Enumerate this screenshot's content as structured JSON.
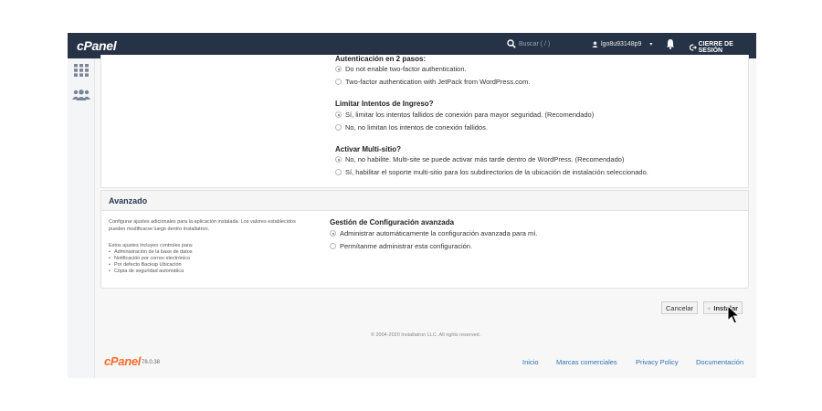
{
  "header": {
    "logo_text": "cPanel",
    "search_placeholder": "Buscar ( / )",
    "user": "lgo8u93148p9",
    "logout": "CIERRE DE SESIÓN"
  },
  "sidebar": {
    "icons": [
      "grid-icon",
      "users-icon"
    ]
  },
  "settings": {
    "two_factor": {
      "title": "Autenticación en 2 pasos:",
      "options": [
        {
          "label": "Do not enable two-factor authentication.",
          "selected": true
        },
        {
          "label": "Two-factor authentication with JetPack from WordPress.com.",
          "selected": false
        }
      ]
    },
    "limit_login": {
      "title": "Limitar Intentos de Ingreso?",
      "options": [
        {
          "label": "Sí, limitar los intentos fallidos de conexión para mayor seguridad. (Recomendado)",
          "selected": true
        },
        {
          "label": "No, no limitan los intentos de conexión fallidos.",
          "selected": false
        }
      ]
    },
    "multisite": {
      "title": "Activar Multi-sitio?",
      "options": [
        {
          "label": "No, no habilite. Multi-site se puede activar más tarde dentro de WordPress. (Recomendado)",
          "selected": true
        },
        {
          "label": "Sí, habilitar el soporte multi-sitio para los subdirectorios de la ubicación de instalación seleccionado.",
          "selected": false
        }
      ]
    }
  },
  "advanced": {
    "title": "Avanzado",
    "description": "Configurar ajustes adicionales para la aplicación instalada. Los valores establecidos pueden modificarse luego dentro Installatron.",
    "includes_intro": "Estos ajustes incluyen controles para:",
    "includes": [
      "Administración de la base de datos",
      "Notificación por correo electrónico",
      "Por defecto Backup Ubicación",
      "Copia de seguridad automática"
    ],
    "config": {
      "title": "Gestión de Configuración avanzada",
      "options": [
        {
          "label": "Administrar automáticamente la configuración avanzada para mí.",
          "selected": true
        },
        {
          "label": "Permítanme administrar esta configuración.",
          "selected": false
        }
      ]
    }
  },
  "actions": {
    "cancel": "Cancelar",
    "install": "Instalar"
  },
  "footer": {
    "copyright": "© 2004-2020 Installatron LLC. All rights reserved.",
    "logo_text": "cPanel",
    "version": "78.0.38",
    "links": [
      "Inicio",
      "Marcas comerciales",
      "Privacy Policy",
      "Documentación"
    ]
  },
  "colors": {
    "header_bg": "#263347",
    "accent_orange": "#ff6c2c",
    "link_blue": "#2f73b7"
  }
}
